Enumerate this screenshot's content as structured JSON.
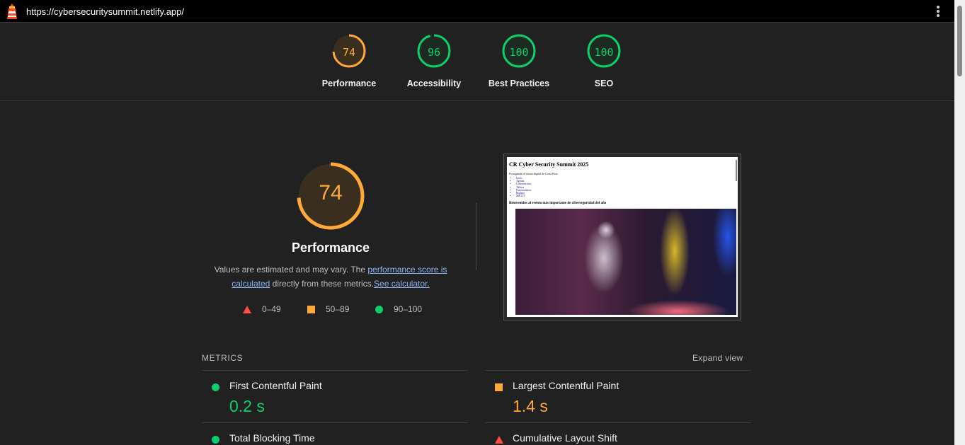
{
  "topbar": {
    "url": "https://cybersecuritysummit.netlify.app/",
    "logo_icon": "lighthouse-icon",
    "menu_icon": "kebab-menu-icon"
  },
  "summary": {
    "gauges": [
      {
        "score": "74",
        "label": "Performance",
        "color": "#ffa938"
      },
      {
        "score": "96",
        "label": "Accessibility",
        "color": "#0cce6b"
      },
      {
        "score": "100",
        "label": "Best Practices",
        "color": "#0cce6b"
      },
      {
        "score": "100",
        "label": "SEO",
        "color": "#0cce6b"
      }
    ]
  },
  "performance": {
    "score": "74",
    "title": "Performance",
    "desc_prefix": "Values are estimated and may vary. The ",
    "desc_link1": "performance score is calculated",
    "desc_middle": " directly from these metrics.",
    "desc_link2": "See calculator.",
    "legend": {
      "fail": "0–49",
      "average": "50–89",
      "pass": "90–100"
    }
  },
  "screenshot": {
    "heading": "CR Cyber Security Summit 2025",
    "tagline": "Protegiendo el futuro digital de Costa Rica",
    "nav": [
      "Inicio",
      "Agenda",
      "Conferencistas",
      "Talleres",
      "Patrocinadores",
      "Registro",
      "MICITT"
    ],
    "subheading": "Bienvenidos al evento más importante de ciberseguridad del año"
  },
  "metrics": {
    "title": "METRICS",
    "expand": "Expand view",
    "items": [
      {
        "name": "First Contentful Paint",
        "value": "0.2 s",
        "rating": "pass"
      },
      {
        "name": "Largest Contentful Paint",
        "value": "1.4 s",
        "rating": "average"
      },
      {
        "name": "Total Blocking Time",
        "value": "",
        "rating": "pass"
      },
      {
        "name": "Cumulative Layout Shift",
        "value": "",
        "rating": "fail"
      }
    ]
  }
}
